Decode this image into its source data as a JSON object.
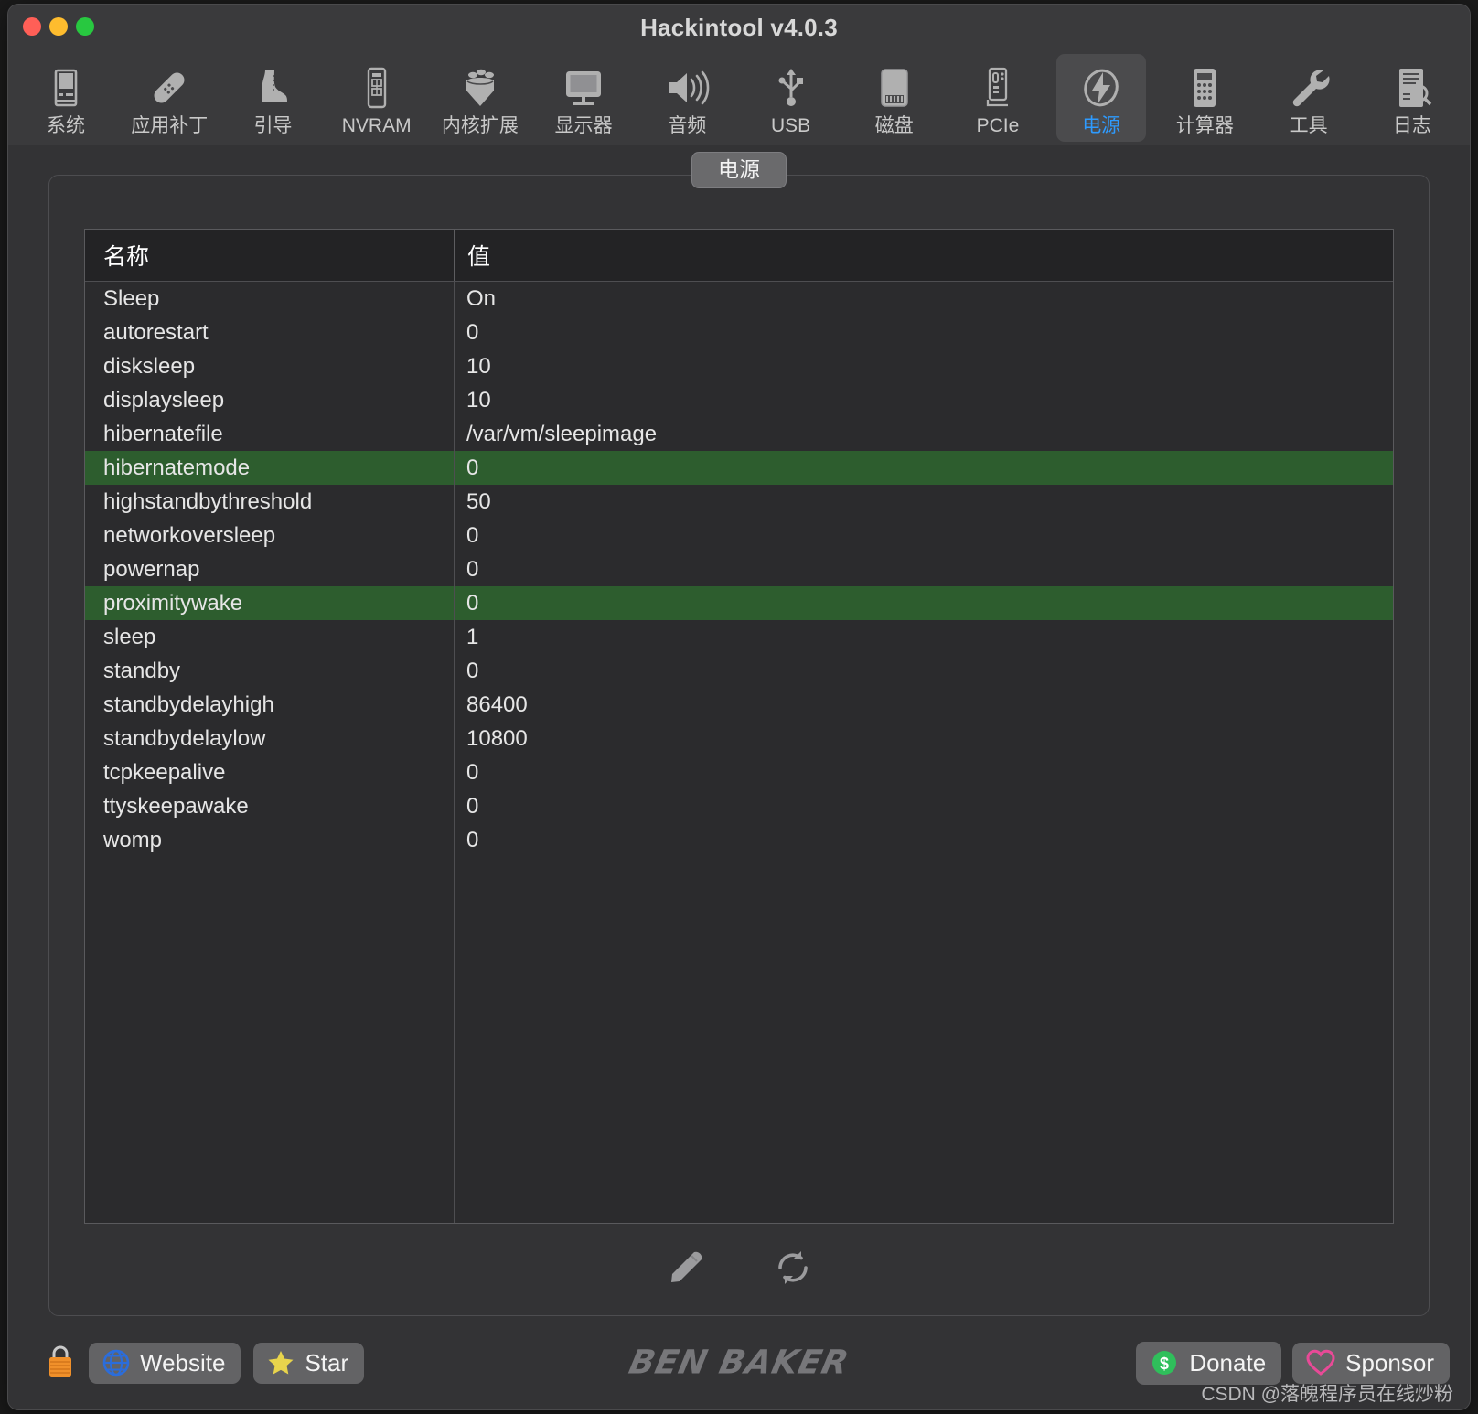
{
  "window": {
    "title": "Hackintool v4.0.3",
    "traffic_lights": [
      "close",
      "minimize",
      "maximize"
    ]
  },
  "toolbar": {
    "items": [
      {
        "label": "系统",
        "icon": "desktop-tower-icon",
        "active": false
      },
      {
        "label": "应用补丁",
        "icon": "bandage-icon",
        "active": false
      },
      {
        "label": "引导",
        "icon": "boot-icon",
        "active": false
      },
      {
        "label": "NVRAM",
        "icon": "memory-chip-icon",
        "active": false
      },
      {
        "label": "内核扩展",
        "icon": "lego-brick-icon",
        "active": false
      },
      {
        "label": "显示器",
        "icon": "monitor-icon",
        "active": false
      },
      {
        "label": "音频",
        "icon": "speaker-icon",
        "active": false
      },
      {
        "label": "USB",
        "icon": "usb-icon",
        "active": false
      },
      {
        "label": "磁盘",
        "icon": "disk-icon",
        "active": false
      },
      {
        "label": "PCIe",
        "icon": "pcie-card-icon",
        "active": false
      },
      {
        "label": "电源",
        "icon": "power-bolt-icon",
        "active": true
      },
      {
        "label": "计算器",
        "icon": "calculator-icon",
        "active": false
      },
      {
        "label": "工具",
        "icon": "wrench-icon",
        "active": false
      },
      {
        "label": "日志",
        "icon": "log-search-icon",
        "active": false
      }
    ]
  },
  "panel": {
    "tab_label": "电源",
    "table": {
      "columns": [
        "名称",
        "值"
      ],
      "rows": [
        {
          "name": "Sleep",
          "value": "On",
          "selected": false
        },
        {
          "name": "autorestart",
          "value": "0",
          "selected": false
        },
        {
          "name": "disksleep",
          "value": "10",
          "selected": false
        },
        {
          "name": "displaysleep",
          "value": "10",
          "selected": false
        },
        {
          "name": "hibernatefile",
          "value": "/var/vm/sleepimage",
          "selected": false
        },
        {
          "name": "hibernatemode",
          "value": "0",
          "selected": true
        },
        {
          "name": "highstandbythreshold",
          "value": "50",
          "selected": false
        },
        {
          "name": "networkoversleep",
          "value": "0",
          "selected": false
        },
        {
          "name": "powernap",
          "value": "0",
          "selected": false
        },
        {
          "name": "proximitywake",
          "value": "0",
          "selected": true
        },
        {
          "name": "sleep",
          "value": "1",
          "selected": false
        },
        {
          "name": "standby",
          "value": "0",
          "selected": false
        },
        {
          "name": "standbydelayhigh",
          "value": "86400",
          "selected": false
        },
        {
          "name": "standbydelaylow",
          "value": "10800",
          "selected": false
        },
        {
          "name": "tcpkeepalive",
          "value": "0",
          "selected": false
        },
        {
          "name": "ttyskeepawake",
          "value": "0",
          "selected": false
        },
        {
          "name": "womp",
          "value": "0",
          "selected": false
        }
      ]
    },
    "actions": [
      {
        "icon": "pencil-edit-icon",
        "name": "edit-action"
      },
      {
        "icon": "refresh-icon",
        "name": "refresh-action"
      }
    ]
  },
  "footer": {
    "lock_icon": "padlock-icon",
    "website_label": "Website",
    "star_label": "Star",
    "brand": "BEN BAKER",
    "donate_label": "Donate",
    "sponsor_label": "Sponsor",
    "watermark": "CSDN @落魄程序员在线炒粉"
  },
  "colors": {
    "window_bg": "#3a3a3c",
    "content_bg": "#333335",
    "table_bg": "#2b2b2d",
    "header_bg": "#232325",
    "selected_row": "#2d5d2e",
    "accent_blue": "#2e9bff",
    "globe_blue": "#2b6ddb",
    "star_yellow": "#e8d44c",
    "donate_green": "#2fbf5b",
    "sponsor_pink": "#e84a97",
    "lock_orange": "#f0902a"
  }
}
